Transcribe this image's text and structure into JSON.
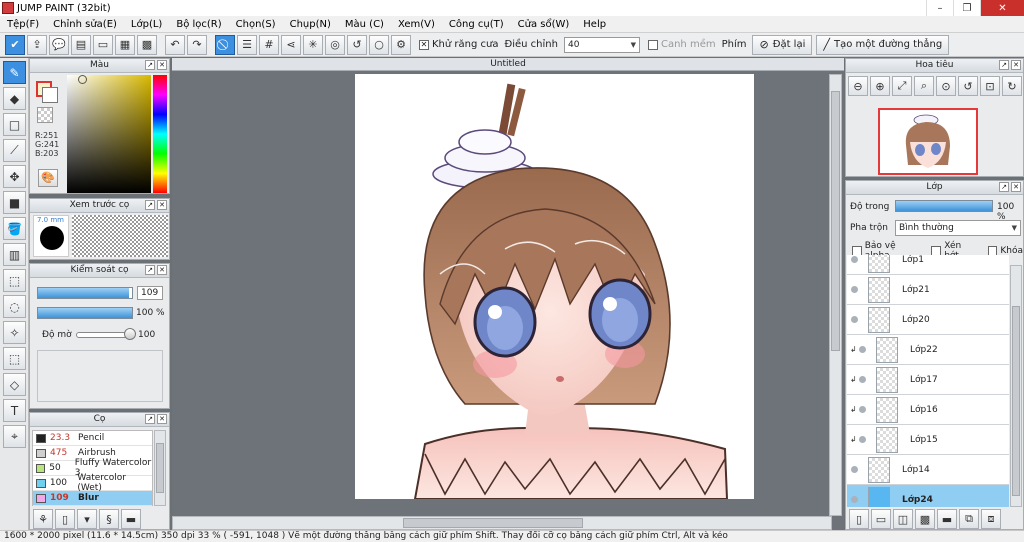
{
  "window": {
    "title": "JUMP PAINT (32bit)",
    "minimize": "–",
    "restore": "❐",
    "close": "✕"
  },
  "menu": [
    "Tệp(F)",
    "Chỉnh sửa(E)",
    "Lớp(L)",
    "Bộ lọc(R)",
    "Chọn(S)",
    "Chụp(N)",
    "Màu (C)",
    "Xem(V)",
    "Công cụ(T)",
    "Cửa sổ(W)",
    "Help"
  ],
  "toolbar": {
    "antialias_label": "Khử răng cưa",
    "adjust_label": "Điều chỉnh",
    "adjust_value": "40",
    "edge_label": "Canh mềm",
    "key_label": "Phím",
    "reset_label": "Đặt lại",
    "straight_line_label": "Tạo một đường thẳng"
  },
  "color_panel": {
    "title": "Màu",
    "r": "R:251",
    "g": "G:241",
    "b": "B:203",
    "primary": "#fbf1cb"
  },
  "preview_panel": {
    "title": "Xem trước cọ",
    "size": "7.0 mm"
  },
  "brush_control": {
    "title": "Kiểm soát cọ",
    "size_value": "109",
    "size_fraction": 0.97,
    "density_value": "100 %",
    "density_fraction": 1.0,
    "opacity_label": "Độ mờ",
    "opacity_value": "100",
    "opacity_fraction": 1.0
  },
  "brush_panel": {
    "title": "Cọ",
    "items": [
      {
        "size": "23.3",
        "name": "Pencil",
        "color": "#222222",
        "selected": false,
        "plain": false
      },
      {
        "size": "475",
        "name": "Airbrush",
        "color": "#cfcfcf",
        "selected": false,
        "plain": false
      },
      {
        "size": "50",
        "name": "Fluffy Watercolor 3",
        "color": "#b8e67a",
        "selected": false,
        "plain": true
      },
      {
        "size": "100",
        "name": "Watercolor (Wet)",
        "color": "#6fd0f0",
        "selected": false,
        "plain": true
      },
      {
        "size": "109",
        "name": "Blur",
        "color": "#f2a8e8",
        "selected": true,
        "plain": false
      }
    ]
  },
  "document": {
    "tab": "Untitled"
  },
  "navigator": {
    "title": "Hoa tiêu"
  },
  "layer_panel": {
    "title": "Lớp",
    "opacity_label": "Độ trong",
    "opacity_value": "100 %",
    "opacity_fraction": 1.0,
    "blend_label": "Pha trộn",
    "blend_value": "Bình thường",
    "protect_alpha": "Bảo vệ alpha",
    "clipping": "Xén bớt",
    "lock": "Khóa",
    "layers": [
      {
        "name": "Lớp1",
        "clipped": false,
        "selected": false
      },
      {
        "name": "Lớp21",
        "clipped": false,
        "selected": false
      },
      {
        "name": "Lớp20",
        "clipped": false,
        "selected": false
      },
      {
        "name": "Lớp22",
        "clipped": true,
        "selected": false
      },
      {
        "name": "Lớp17",
        "clipped": true,
        "selected": false
      },
      {
        "name": "Lớp16",
        "clipped": true,
        "selected": false
      },
      {
        "name": "Lớp15",
        "clipped": true,
        "selected": false
      },
      {
        "name": "Lớp14",
        "clipped": false,
        "selected": false
      },
      {
        "name": "Lớp24",
        "clipped": false,
        "selected": true
      }
    ]
  },
  "status": {
    "text": "1600 * 2000 pixel  (11.6 * 14.5cm)  350 dpi  33 %  ( -591, 1048 )  Vẽ một đường thẳng bằng cách giữ phím Shift. Thay đổi cỡ cọ bằng cách giữ phím Ctrl, Alt và kéo"
  }
}
